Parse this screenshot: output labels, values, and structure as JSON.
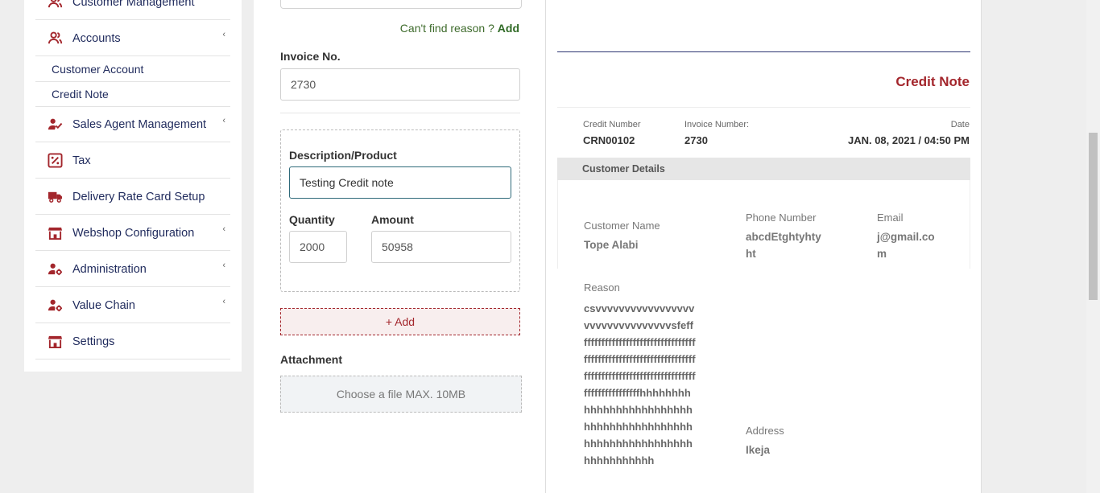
{
  "sidebar": {
    "items": [
      {
        "label": "Customer Management",
        "icon": "users-icon",
        "chevron": "‹"
      },
      {
        "label": "Accounts",
        "icon": "users-icon",
        "chevron": "‹"
      },
      {
        "label": "Sales Agent Management",
        "icon": "user-check-icon",
        "chevron": "‹"
      },
      {
        "label": "Tax",
        "icon": "percent-icon",
        "chevron": ""
      },
      {
        "label": "Delivery Rate Card Setup",
        "icon": "truck-icon",
        "chevron": ""
      },
      {
        "label": "Webshop Configuration",
        "icon": "store-icon",
        "chevron": "‹"
      },
      {
        "label": "Administration",
        "icon": "user-gear-icon",
        "chevron": "‹"
      },
      {
        "label": "Value Chain",
        "icon": "user-gear-icon",
        "chevron": "‹"
      },
      {
        "label": "Settings",
        "icon": "store-icon",
        "chevron": ""
      }
    ],
    "sub_items": [
      {
        "label": "Customer Account"
      },
      {
        "label": "Credit Note"
      }
    ]
  },
  "form": {
    "cant_find_text": "Can't find reason ?",
    "cant_find_add": "Add",
    "invoice_label": "Invoice No.",
    "invoice_value": "2730",
    "description_label": "Description/Product",
    "description_value": "Testing Credit note",
    "quantity_label": "Quantity",
    "quantity_value": "2000",
    "amount_label": "Amount",
    "amount_value": "50958",
    "add_label": "+ Add",
    "attachment_label": "Attachment",
    "file_placeholder": "Choose a file MAX. 10MB"
  },
  "preview": {
    "title": "Credit Note",
    "credit_number_label": "Credit Number",
    "credit_number_value": "CRN00102",
    "invoice_number_label": "Invoice Number:",
    "invoice_number_value": "2730",
    "date_label": "Date",
    "date_value": "JAN. 08, 2021 / 04:50 PM",
    "customer_details_label": "Customer Details",
    "customer_name_label": "Customer Name",
    "customer_name_value": "Tope Alabi",
    "phone_label": "Phone Number",
    "phone_value": "abcdEtghtyhtyht",
    "email_label": "Email",
    "email_value": "j@gmail.com",
    "reason_label": "Reason",
    "reason_value": "csvvvvvvvvvvvvvvvvvvvvvvvvvvvvvvvvsfeffffffffffffffffffffffffffffffffffffffffffffffffffffffffffffffffffffffffffffffffffffffffffffffffffffffffffffffffffhhhhhhhhhhhhhhhhhhhhhhhhhhhhhhhhhhhhhhhhhhhhhhhhhhhhhhhhhhhhhhhhhhhhhh",
    "address_label": "Address",
    "address_value": "Ikeja"
  },
  "colors": {
    "accent_red": "#a3262c",
    "navy": "#1f2a5c",
    "green_link": "#2f6a25"
  }
}
